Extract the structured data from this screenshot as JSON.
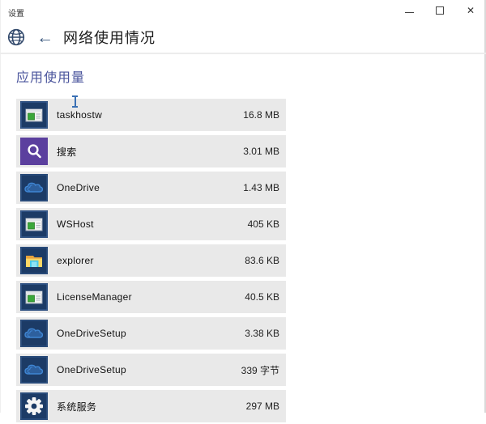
{
  "window": {
    "title": "设置",
    "controls": {
      "minimize": "minimize",
      "maximize": "maximize",
      "close": "✕"
    }
  },
  "header": {
    "globe_icon": "globe-icon",
    "back_label": "←",
    "title": "网络使用情况"
  },
  "section": {
    "title": "应用使用量"
  },
  "app_list": [
    {
      "name": "taskhostw",
      "usage": "16.8 MB",
      "icon": "window-app-icon",
      "icon_type": "window"
    },
    {
      "name": "搜索",
      "usage": "3.01 MB",
      "icon": "search-app-icon",
      "icon_type": "search"
    },
    {
      "name": "OneDrive",
      "usage": "1.43 MB",
      "icon": "cloud-app-icon",
      "icon_type": "cloud"
    },
    {
      "name": "WSHost",
      "usage": "405 KB",
      "icon": "window-app-icon",
      "icon_type": "window"
    },
    {
      "name": "explorer",
      "usage": "83.6 KB",
      "icon": "folder-app-icon",
      "icon_type": "folder"
    },
    {
      "name": "LicenseManager",
      "usage": "40.5 KB",
      "icon": "window-app-icon",
      "icon_type": "window"
    },
    {
      "name": "OneDriveSetup",
      "usage": "3.38 KB",
      "icon": "cloud-app-icon",
      "icon_type": "cloud"
    },
    {
      "name": "OneDriveSetup",
      "usage": "339 字节",
      "icon": "cloud-app-icon",
      "icon_type": "cloud"
    },
    {
      "name": "系统服务",
      "usage": "297 MB",
      "icon": "gear-app-icon",
      "icon_type": "gear"
    }
  ],
  "ui_state": {
    "text_cursor_over": "taskhostw"
  },
  "colors": {
    "accent_section_title": "#4a549c",
    "row_background": "#e9e9e9",
    "tile_navy": "#1c3b66",
    "tile_purple": "#5b3f9e",
    "cursor_blue": "#3a70b4"
  }
}
